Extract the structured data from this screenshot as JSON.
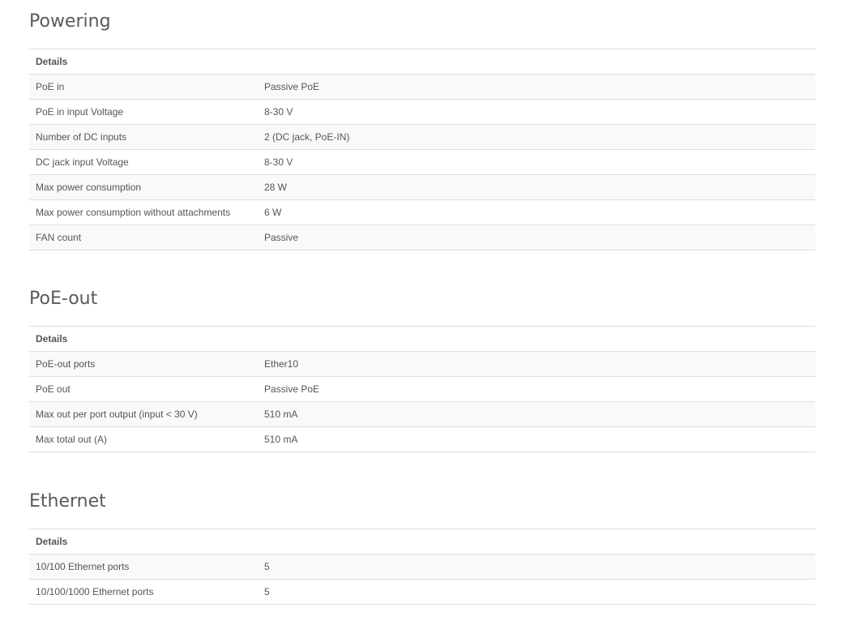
{
  "sections": [
    {
      "title": "Powering",
      "header": "Details",
      "rows": [
        {
          "label": "PoE in",
          "value": "Passive PoE"
        },
        {
          "label": "PoE in input Voltage",
          "value": "8-30 V"
        },
        {
          "label": "Number of DC inputs",
          "value": "2 (DC jack, PoE-IN)"
        },
        {
          "label": "DC jack input Voltage",
          "value": "8-30 V"
        },
        {
          "label": "Max power consumption",
          "value": "28 W"
        },
        {
          "label": "Max power consumption without attachments",
          "value": "6 W"
        },
        {
          "label": "FAN count",
          "value": "Passive"
        }
      ]
    },
    {
      "title": "PoE-out",
      "header": "Details",
      "rows": [
        {
          "label": "PoE-out ports",
          "value": "Ether10"
        },
        {
          "label": "PoE out",
          "value": "Passive PoE"
        },
        {
          "label": "Max out per port output (input < 30 V)",
          "value": "510 mA"
        },
        {
          "label": "Max total out (A)",
          "value": "510 mA"
        }
      ]
    },
    {
      "title": "Ethernet",
      "header": "Details",
      "rows": [
        {
          "label": "10/100 Ethernet ports",
          "value": "5"
        },
        {
          "label": "10/100/1000 Ethernet ports",
          "value": "5"
        }
      ]
    }
  ]
}
